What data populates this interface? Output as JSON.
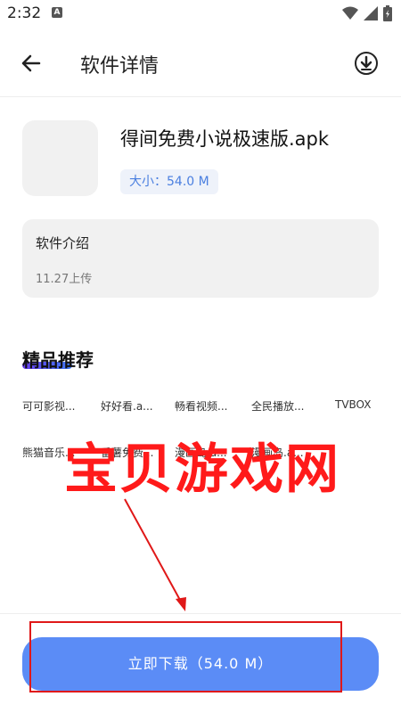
{
  "status_bar": {
    "time": "2:32",
    "notif_letter": "A"
  },
  "header": {
    "title": "软件详情"
  },
  "app": {
    "name": "得间免费小说极速版.apk",
    "size_label": "大小：54.0 M"
  },
  "intro": {
    "title": "软件介绍",
    "date": "11.27上传"
  },
  "recommend": {
    "title": "精品推荐",
    "items": [
      "可可影视...",
      "好好看.a...",
      "畅看视频...",
      "全民播放...",
      "TVBOX",
      "熊猫音乐...",
      "番薯免费...",
      "漫画岛.a...",
      "漫画岛.a..."
    ]
  },
  "watermark": "宝贝游戏网",
  "download": {
    "label": "立即下载（54.0 M）"
  },
  "colors": {
    "accent": "#5b8cf6",
    "annotation_red": "#e01818"
  }
}
